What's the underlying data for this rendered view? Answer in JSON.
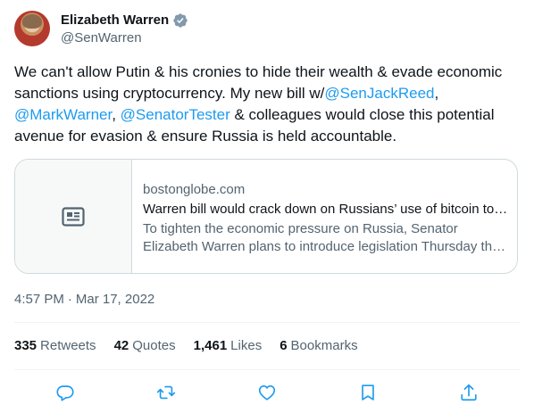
{
  "author": {
    "display_name": "Elizabeth Warren",
    "handle": "@SenWarren"
  },
  "tweet": {
    "segments": [
      {
        "type": "text",
        "text": "We can't allow Putin & his cronies to hide their wealth & evade economic sanctions using cryptocurrency. My new bill w/"
      },
      {
        "type": "mention",
        "text": "@SenJackReed"
      },
      {
        "type": "text",
        "text": ", "
      },
      {
        "type": "mention",
        "text": "@MarkWarner"
      },
      {
        "type": "text",
        "text": ", "
      },
      {
        "type": "mention",
        "text": "@SenatorTester"
      },
      {
        "type": "text",
        "text": " & colleagues would close this potential avenue for evasion & ensure Russia is held accountable."
      }
    ]
  },
  "card": {
    "domain": "bostonglobe.com",
    "title": "Warren bill would crack down on Russians’ use of bitcoin to evade sanctions",
    "description": "To tighten the economic pressure on Russia, Senator Elizabeth Warren plans to introduce legislation Thursday that would crack down on Russians’ use of cryptocurrency."
  },
  "timestamp": {
    "time": "4:57 PM",
    "separator": "·",
    "date": "Mar 17, 2022"
  },
  "stats": {
    "retweets_count": "335",
    "retweets_label": "Retweets",
    "quotes_count": "42",
    "quotes_label": "Quotes",
    "likes_count": "1,461",
    "likes_label": "Likes",
    "bookmarks_count": "6",
    "bookmarks_label": "Bookmarks"
  },
  "actions": [
    "reply-icon",
    "retweet-icon",
    "like-icon",
    "bookmark-icon",
    "share-icon"
  ],
  "colors": {
    "accent": "#1d9bf0",
    "text": "#0f1419",
    "secondary": "#536471",
    "border": "#cfd9de"
  }
}
